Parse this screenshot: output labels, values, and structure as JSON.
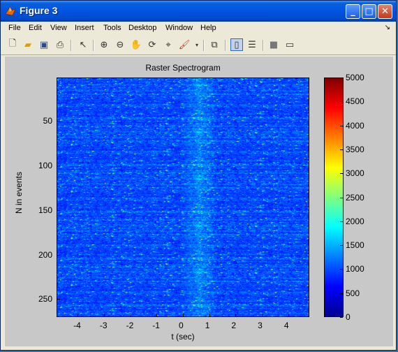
{
  "window": {
    "title": "Figure 3"
  },
  "menu": [
    "File",
    "Edit",
    "View",
    "Insert",
    "Tools",
    "Desktop",
    "Window",
    "Help"
  ],
  "toolbar": {
    "icons": [
      "new-file-icon",
      "open-folder-icon",
      "save-icon",
      "print-icon",
      "pointer-icon",
      "zoom-in-icon",
      "zoom-out-icon",
      "pan-hand-icon",
      "rotate-3d-icon",
      "data-cursor-icon",
      "brush-icon",
      "link-icon",
      "plot-browser-icon",
      "colorbar-icon",
      "legend-icon",
      "hide-tools-icon",
      "show-tools-icon"
    ]
  },
  "chart_data": {
    "type": "heatmap",
    "title": "Raster Spectrogram",
    "xlabel": "t (sec)",
    "ylabel": "N in events",
    "xlim": [
      -4.8,
      4.8
    ],
    "ylim": [
      1,
      270
    ],
    "x_ticks": [
      -4,
      -3,
      -2,
      -1,
      0,
      1,
      2,
      3,
      4
    ],
    "y_ticks": [
      50,
      100,
      150,
      200,
      250
    ],
    "colorbar": {
      "range": [
        0,
        5000
      ],
      "ticks": [
        0,
        500,
        1000,
        1500,
        2000,
        2500,
        3000,
        3500,
        4000,
        4500,
        5000
      ],
      "colormap": "jet"
    },
    "description_values": "noise-like raster, mostly 500-1500, with sparse peaks up to 5000; slightly higher activity near t=0.5"
  },
  "colors": {
    "accent": "#0054e3",
    "figure_bg": "#c8c8c8"
  }
}
